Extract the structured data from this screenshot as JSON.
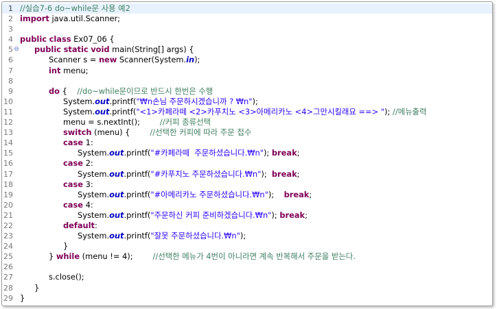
{
  "editor": {
    "lines": [
      {
        "n": "1",
        "current": true,
        "fold": "",
        "indent": 0,
        "tokens": [
          {
            "t": "cmt",
            "v": "//실습7-6 do~while문 사용 예2"
          }
        ]
      },
      {
        "n": "2",
        "fold": "",
        "indent": 0,
        "tokens": [
          {
            "t": "kw",
            "v": "import"
          },
          {
            "t": "plain",
            "v": " java.util.Scanner;"
          }
        ]
      },
      {
        "n": "3",
        "fold": "",
        "indent": 0,
        "tokens": []
      },
      {
        "n": "4",
        "fold": "",
        "indent": 0,
        "tokens": [
          {
            "t": "kw",
            "v": "public"
          },
          {
            "t": "plain",
            "v": " "
          },
          {
            "t": "kw",
            "v": "class"
          },
          {
            "t": "plain",
            "v": " Ex07_06 {"
          }
        ]
      },
      {
        "n": "5",
        "fold": "⊖",
        "indent": 1,
        "tokens": [
          {
            "t": "kw",
            "v": "public"
          },
          {
            "t": "plain",
            "v": " "
          },
          {
            "t": "kw",
            "v": "static"
          },
          {
            "t": "plain",
            "v": " "
          },
          {
            "t": "kw",
            "v": "void"
          },
          {
            "t": "plain",
            "v": " main(String[] args) {"
          }
        ]
      },
      {
        "n": "6",
        "fold": "",
        "indent": 2,
        "tokens": [
          {
            "t": "plain",
            "v": "Scanner s = "
          },
          {
            "t": "kw",
            "v": "new"
          },
          {
            "t": "plain",
            "v": " Scanner(System."
          },
          {
            "t": "fld",
            "v": "in"
          },
          {
            "t": "plain",
            "v": ");"
          }
        ]
      },
      {
        "n": "7",
        "fold": "",
        "indent": 2,
        "tokens": [
          {
            "t": "kw",
            "v": "int"
          },
          {
            "t": "plain",
            "v": " menu;"
          }
        ]
      },
      {
        "n": "8",
        "fold": "",
        "indent": 0,
        "tokens": []
      },
      {
        "n": "9",
        "fold": "",
        "indent": 2,
        "tokens": [
          {
            "t": "kw",
            "v": "do"
          },
          {
            "t": "plain",
            "v": " {    "
          },
          {
            "t": "cmt",
            "v": "//do~while문이므로 반드시 한번은 수행"
          }
        ]
      },
      {
        "n": "10",
        "fold": "",
        "indent": 3,
        "tokens": [
          {
            "t": "plain",
            "v": "System."
          },
          {
            "t": "fld",
            "v": "out"
          },
          {
            "t": "plain",
            "v": ".printf("
          },
          {
            "t": "str",
            "v": "\"₩n손님 주문하시겠습니까 ? ₩n\""
          },
          {
            "t": "plain",
            "v": ");"
          }
        ]
      },
      {
        "n": "11",
        "fold": "",
        "indent": 3,
        "tokens": [
          {
            "t": "plain",
            "v": "System."
          },
          {
            "t": "fld",
            "v": "out"
          },
          {
            "t": "plain",
            "v": ".printf("
          },
          {
            "t": "str",
            "v": "\"<1>카페라떼 <2>카푸치노 <3>아메리카노 <4>그만시킬래요 ==> \""
          },
          {
            "t": "plain",
            "v": "); "
          },
          {
            "t": "cmt",
            "v": "//메뉴출력"
          }
        ]
      },
      {
        "n": "12",
        "fold": "",
        "indent": 3,
        "tokens": [
          {
            "t": "plain",
            "v": "menu = s.nextInt();        "
          },
          {
            "t": "cmt",
            "v": "//커피 종류선택"
          }
        ]
      },
      {
        "n": "13",
        "fold": "",
        "indent": 3,
        "tokens": [
          {
            "t": "kw",
            "v": "switch"
          },
          {
            "t": "plain",
            "v": " (menu) {        "
          },
          {
            "t": "cmt",
            "v": "//선택한 커피에 따라 주문 접수"
          }
        ]
      },
      {
        "n": "14",
        "fold": "",
        "indent": 3,
        "tokens": [
          {
            "t": "kw",
            "v": "case"
          },
          {
            "t": "plain",
            "v": " 1:"
          }
        ]
      },
      {
        "n": "15",
        "fold": "",
        "indent": 4,
        "tokens": [
          {
            "t": "plain",
            "v": "System."
          },
          {
            "t": "fld",
            "v": "out"
          },
          {
            "t": "plain",
            "v": ".printf("
          },
          {
            "t": "str",
            "v": "\"#카페라떼  주문하셨습니다.₩n\""
          },
          {
            "t": "plain",
            "v": "); "
          },
          {
            "t": "kw",
            "v": "break"
          },
          {
            "t": "plain",
            "v": ";"
          }
        ]
      },
      {
        "n": "16",
        "fold": "",
        "indent": 3,
        "tokens": [
          {
            "t": "kw",
            "v": "case"
          },
          {
            "t": "plain",
            "v": " 2:"
          }
        ]
      },
      {
        "n": "17",
        "fold": "",
        "indent": 4,
        "tokens": [
          {
            "t": "plain",
            "v": "System."
          },
          {
            "t": "fld",
            "v": "out"
          },
          {
            "t": "plain",
            "v": ".printf("
          },
          {
            "t": "str",
            "v": "\"#카푸치노 주문하셨습니다.₩n\""
          },
          {
            "t": "plain",
            "v": ");  "
          },
          {
            "t": "kw",
            "v": "break"
          },
          {
            "t": "plain",
            "v": ";"
          }
        ]
      },
      {
        "n": "18",
        "fold": "",
        "indent": 3,
        "tokens": [
          {
            "t": "kw",
            "v": "case"
          },
          {
            "t": "plain",
            "v": " 3:"
          }
        ]
      },
      {
        "n": "19",
        "fold": "",
        "indent": 4,
        "tokens": [
          {
            "t": "plain",
            "v": "System."
          },
          {
            "t": "fld",
            "v": "out"
          },
          {
            "t": "plain",
            "v": ".printf("
          },
          {
            "t": "str",
            "v": "\"#아메리카노 주문하셨습니다.₩n\""
          },
          {
            "t": "plain",
            "v": ");    "
          },
          {
            "t": "kw",
            "v": "break"
          },
          {
            "t": "plain",
            "v": ";"
          }
        ]
      },
      {
        "n": "20",
        "fold": "",
        "indent": 3,
        "tokens": [
          {
            "t": "kw",
            "v": "case"
          },
          {
            "t": "plain",
            "v": " 4:"
          }
        ]
      },
      {
        "n": "21",
        "fold": "",
        "indent": 4,
        "tokens": [
          {
            "t": "plain",
            "v": "System."
          },
          {
            "t": "fld",
            "v": "out"
          },
          {
            "t": "plain",
            "v": ".printf("
          },
          {
            "t": "str",
            "v": "\"주문하신 커피 준비하겠습니다.₩n\""
          },
          {
            "t": "plain",
            "v": "); "
          },
          {
            "t": "kw",
            "v": "break"
          },
          {
            "t": "plain",
            "v": ";"
          }
        ]
      },
      {
        "n": "22",
        "fold": "",
        "indent": 3,
        "tokens": [
          {
            "t": "kw",
            "v": "default"
          },
          {
            "t": "plain",
            "v": ":"
          }
        ]
      },
      {
        "n": "23",
        "fold": "",
        "indent": 4,
        "tokens": [
          {
            "t": "plain",
            "v": "System."
          },
          {
            "t": "fld",
            "v": "out"
          },
          {
            "t": "plain",
            "v": ".printf("
          },
          {
            "t": "str",
            "v": "\"잘못 주문하셨습니다.₩n\""
          },
          {
            "t": "plain",
            "v": ");"
          }
        ]
      },
      {
        "n": "24",
        "fold": "",
        "indent": 3,
        "tokens": [
          {
            "t": "plain",
            "v": "}"
          }
        ]
      },
      {
        "n": "25",
        "fold": "",
        "indent": 2,
        "tokens": [
          {
            "t": "plain",
            "v": "} "
          },
          {
            "t": "kw",
            "v": "while"
          },
          {
            "t": "plain",
            "v": " (menu != 4);        "
          },
          {
            "t": "cmt",
            "v": "//선택한 메뉴가 4번이 아니라면 계속 반복해서 주문을 받는다."
          }
        ]
      },
      {
        "n": "26",
        "fold": "",
        "indent": 0,
        "tokens": []
      },
      {
        "n": "27",
        "fold": "",
        "indent": 2,
        "tokens": [
          {
            "t": "plain",
            "v": "s.close();"
          }
        ]
      },
      {
        "n": "28",
        "fold": "",
        "indent": 1,
        "tokens": [
          {
            "t": "plain",
            "v": "}"
          }
        ]
      },
      {
        "n": "29",
        "fold": "",
        "indent": 0,
        "tokens": [
          {
            "t": "plain",
            "v": "}"
          }
        ]
      }
    ]
  }
}
